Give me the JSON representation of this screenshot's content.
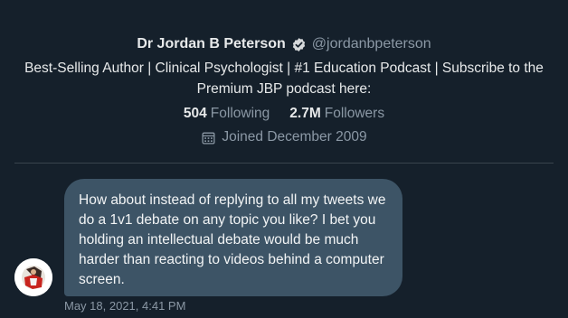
{
  "profile": {
    "display_name": "Dr Jordan B Peterson",
    "handle": "@jordanbpeterson",
    "bio": "Best-Selling Author | Clinical Psychologist | #1 Education Podcast | Subscribe to the Premium JBP podcast here:",
    "following_count": "504",
    "following_label": "Following",
    "followers_count": "2.7M",
    "followers_label": "Followers",
    "joined": "Joined December 2009",
    "verified_icon": "verified-badge-icon",
    "calendar_icon": "calendar-icon"
  },
  "message": {
    "text": "How about instead of replying to all my tweets we do a 1v1 debate on any topic you like? I bet you holding an intellectual debate would be much harder than reacting to videos behind a computer screen.",
    "timestamp": "May 18, 2021, 4:41 PM"
  },
  "colors": {
    "background": "#15202b",
    "bubble": "#3d5466",
    "muted_text": "#8b98a5",
    "divider": "#38444d"
  }
}
